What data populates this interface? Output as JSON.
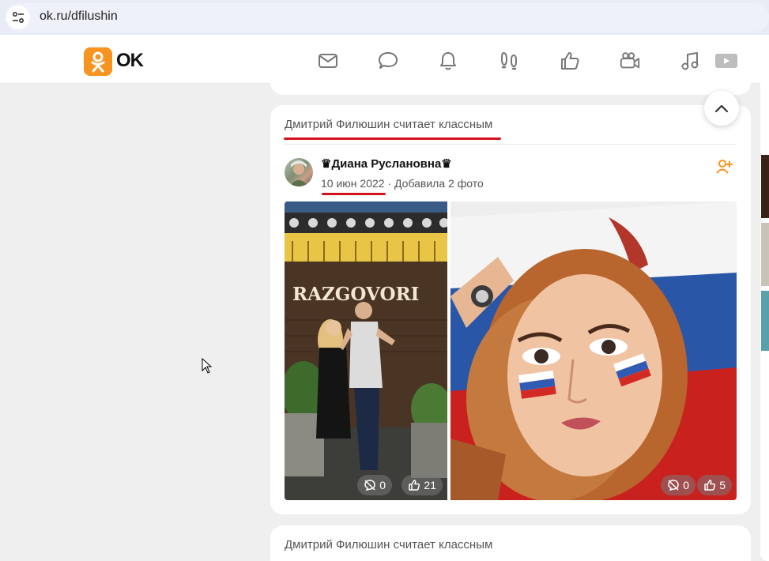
{
  "browser": {
    "url": "ok.ru/dfilushin"
  },
  "header": {
    "logo_text": "OK",
    "nav_icons": [
      "mail-icon",
      "chat-icon",
      "bell-icon",
      "guests-icon",
      "like-icon",
      "video-camera-icon",
      "music-icon",
      "video-play-icon"
    ]
  },
  "feed": {
    "card": {
      "header": "Дмитрий Филюшин считает классным",
      "author": "♛Диана Руслановна♛",
      "date": "10 июн 2022",
      "separator": "·",
      "action": "Добавила 2 фото",
      "photos": [
        {
          "sign_text": "RAZGOVORI",
          "comments": "0",
          "likes": "21"
        },
        {
          "comments": "0",
          "likes": "5"
        }
      ]
    },
    "next_card": {
      "header": "Дмитрий Филюшин считает классным"
    }
  },
  "colors": {
    "accent": "#f7931e",
    "underline": "#d4101d"
  }
}
